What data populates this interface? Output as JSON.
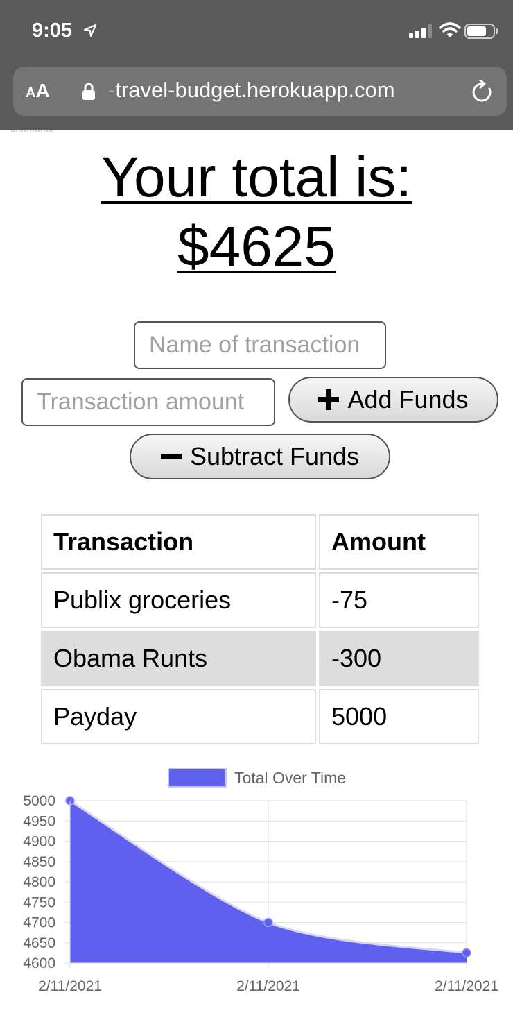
{
  "status_bar": {
    "time": "9:05"
  },
  "browser": {
    "aa_label_small": "A",
    "aa_label_large": "A",
    "url_faded": "-",
    "url": "travel-budget.herokuapp.com"
  },
  "heading": {
    "line1": "Your total is:",
    "line2": "$4625"
  },
  "form": {
    "name_placeholder": "Name of transaction",
    "amount_placeholder": "Transaction amount",
    "add_label": "Add Funds",
    "subtract_label": "Subtract Funds"
  },
  "table": {
    "headers": [
      "Transaction",
      "Amount"
    ],
    "rows": [
      {
        "name": "Publix groceries",
        "amount": "-75"
      },
      {
        "name": "Obama Runts",
        "amount": "-300"
      },
      {
        "name": "Payday",
        "amount": "5000"
      }
    ]
  },
  "chart_data": {
    "type": "area",
    "title": "",
    "xlabel": "",
    "ylabel": "",
    "categories": [
      "2/11/2021",
      "2/11/2021",
      "2/11/2021"
    ],
    "series": [
      {
        "name": "Total Over Time",
        "values": [
          5000,
          4700,
          4625
        ],
        "color": "#6060ee"
      }
    ],
    "ylim": [
      4600,
      5000
    ],
    "yticks": [
      5000,
      4950,
      4900,
      4850,
      4800,
      4750,
      4700,
      4650,
      4600
    ],
    "grid": true,
    "legend": "top"
  }
}
